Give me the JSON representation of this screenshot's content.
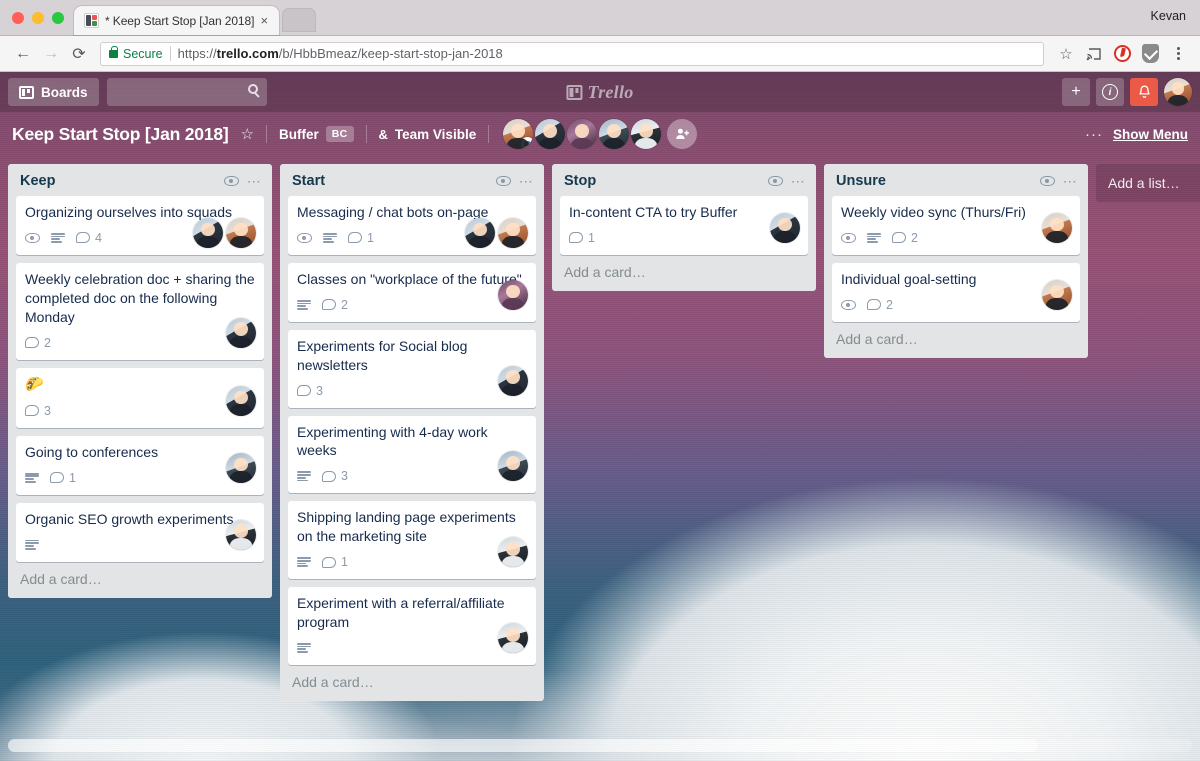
{
  "browser": {
    "window_user": "Kevan",
    "tab": {
      "title": "* Keep Start Stop [Jan 2018] |",
      "close_label": "×"
    },
    "nav": {
      "back": "←",
      "forward": "→",
      "reload": "⟳"
    },
    "omnibox": {
      "secure_label": "Secure",
      "url_prefix": "https://",
      "url_domain": "trello.com",
      "url_path": "/b/HbbBmeaz/keep-start-stop-jan-2018"
    },
    "icons": {
      "bookmark": "☆",
      "cast": "cast-icon",
      "ghostery": "ghostery-icon",
      "lastpass": "lastpass-icon",
      "menu": "kebab-menu-icon"
    }
  },
  "trello_header": {
    "boards_label": "Boards",
    "search_placeholder": "",
    "logo_text": "Trello",
    "add_label": "+",
    "info_label": "i",
    "notifications_label": "🔔"
  },
  "board": {
    "title": "Keep Start Stop [Jan 2018]",
    "star": "☆",
    "team_name": "Buffer",
    "team_initials": "BC",
    "visibility": "Team Visible",
    "visibility_icon": "&",
    "add_member_label": "+",
    "menu_dots": "···",
    "show_menu_label": "Show Menu",
    "members": [
      {
        "name": "member-1",
        "style": "a-kev"
      },
      {
        "name": "member-2",
        "style": "a-ben"
      },
      {
        "name": "member-3",
        "style": "a-art"
      },
      {
        "name": "member-4",
        "style": "a-sunset"
      },
      {
        "name": "member-5",
        "style": "a-dave"
      }
    ]
  },
  "lists": [
    {
      "name": "Keep",
      "add_card_label": "Add a card…",
      "cards": [
        {
          "title": "Organizing ourselves into squads",
          "watching": true,
          "description": true,
          "comments": "4",
          "avatars": [
            "a-ben",
            "a-kev"
          ]
        },
        {
          "title": "Weekly celebration doc + sharing the completed doc on the following Monday",
          "watching": false,
          "description": false,
          "comments": "2",
          "avatars": [
            "a-ben"
          ]
        },
        {
          "title": "🌮",
          "watching": false,
          "description": false,
          "comments": "3",
          "avatars": [
            "a-ben"
          ]
        },
        {
          "title": "Going to conferences",
          "watching": false,
          "description": true,
          "comments": "1",
          "avatars": [
            "a-sunset"
          ]
        },
        {
          "title": "Organic SEO growth experiments",
          "watching": false,
          "description": true,
          "comments": null,
          "avatars": [
            "a-dave"
          ]
        }
      ]
    },
    {
      "name": "Start",
      "add_card_label": "Add a card…",
      "cards": [
        {
          "title": "Messaging / chat bots on-page",
          "watching": true,
          "description": true,
          "comments": "1",
          "avatars": [
            "a-ben",
            "a-kev"
          ]
        },
        {
          "title": "Classes on \"workplace of the future\"",
          "watching": false,
          "description": true,
          "comments": "2",
          "avatars": [
            "a-art"
          ]
        },
        {
          "title": "Experiments for Social blog newsletters",
          "watching": false,
          "description": false,
          "comments": "3",
          "avatars": [
            "a-ben"
          ]
        },
        {
          "title": "Experimenting with 4-day work weeks",
          "watching": false,
          "description": true,
          "comments": "3",
          "avatars": [
            "a-sunset"
          ]
        },
        {
          "title": "Shipping landing page experiments on the marketing site",
          "watching": false,
          "description": true,
          "comments": "1",
          "avatars": [
            "a-dave"
          ]
        },
        {
          "title": "Experiment with a referral/affiliate program",
          "watching": false,
          "description": true,
          "comments": null,
          "avatars": [
            "a-dave"
          ]
        }
      ]
    },
    {
      "name": "Stop",
      "add_card_label": "Add a card…",
      "cards": [
        {
          "title": "In-content CTA to try Buffer",
          "watching": false,
          "description": false,
          "comments": "1",
          "avatars": [
            "a-ben"
          ]
        }
      ]
    },
    {
      "name": "Unsure",
      "add_card_label": "Add a card…",
      "cards": [
        {
          "title": "Weekly video sync (Thurs/Fri)",
          "watching": true,
          "description": true,
          "comments": "2",
          "avatars": [
            "a-kev"
          ]
        },
        {
          "title": "Individual goal-setting",
          "watching": true,
          "description": false,
          "comments": "2",
          "avatars": [
            "a-kev"
          ]
        }
      ]
    }
  ],
  "add_list_label": "Add a list…",
  "colors": {
    "header": "#8a4f73",
    "list_bg": "#e2e4e6",
    "card_bg": "#ffffff",
    "card_text": "#172b4d",
    "badge_gray": "#8c9bab",
    "notification_red": "#eb5a46",
    "secure_green": "#0b8043"
  }
}
